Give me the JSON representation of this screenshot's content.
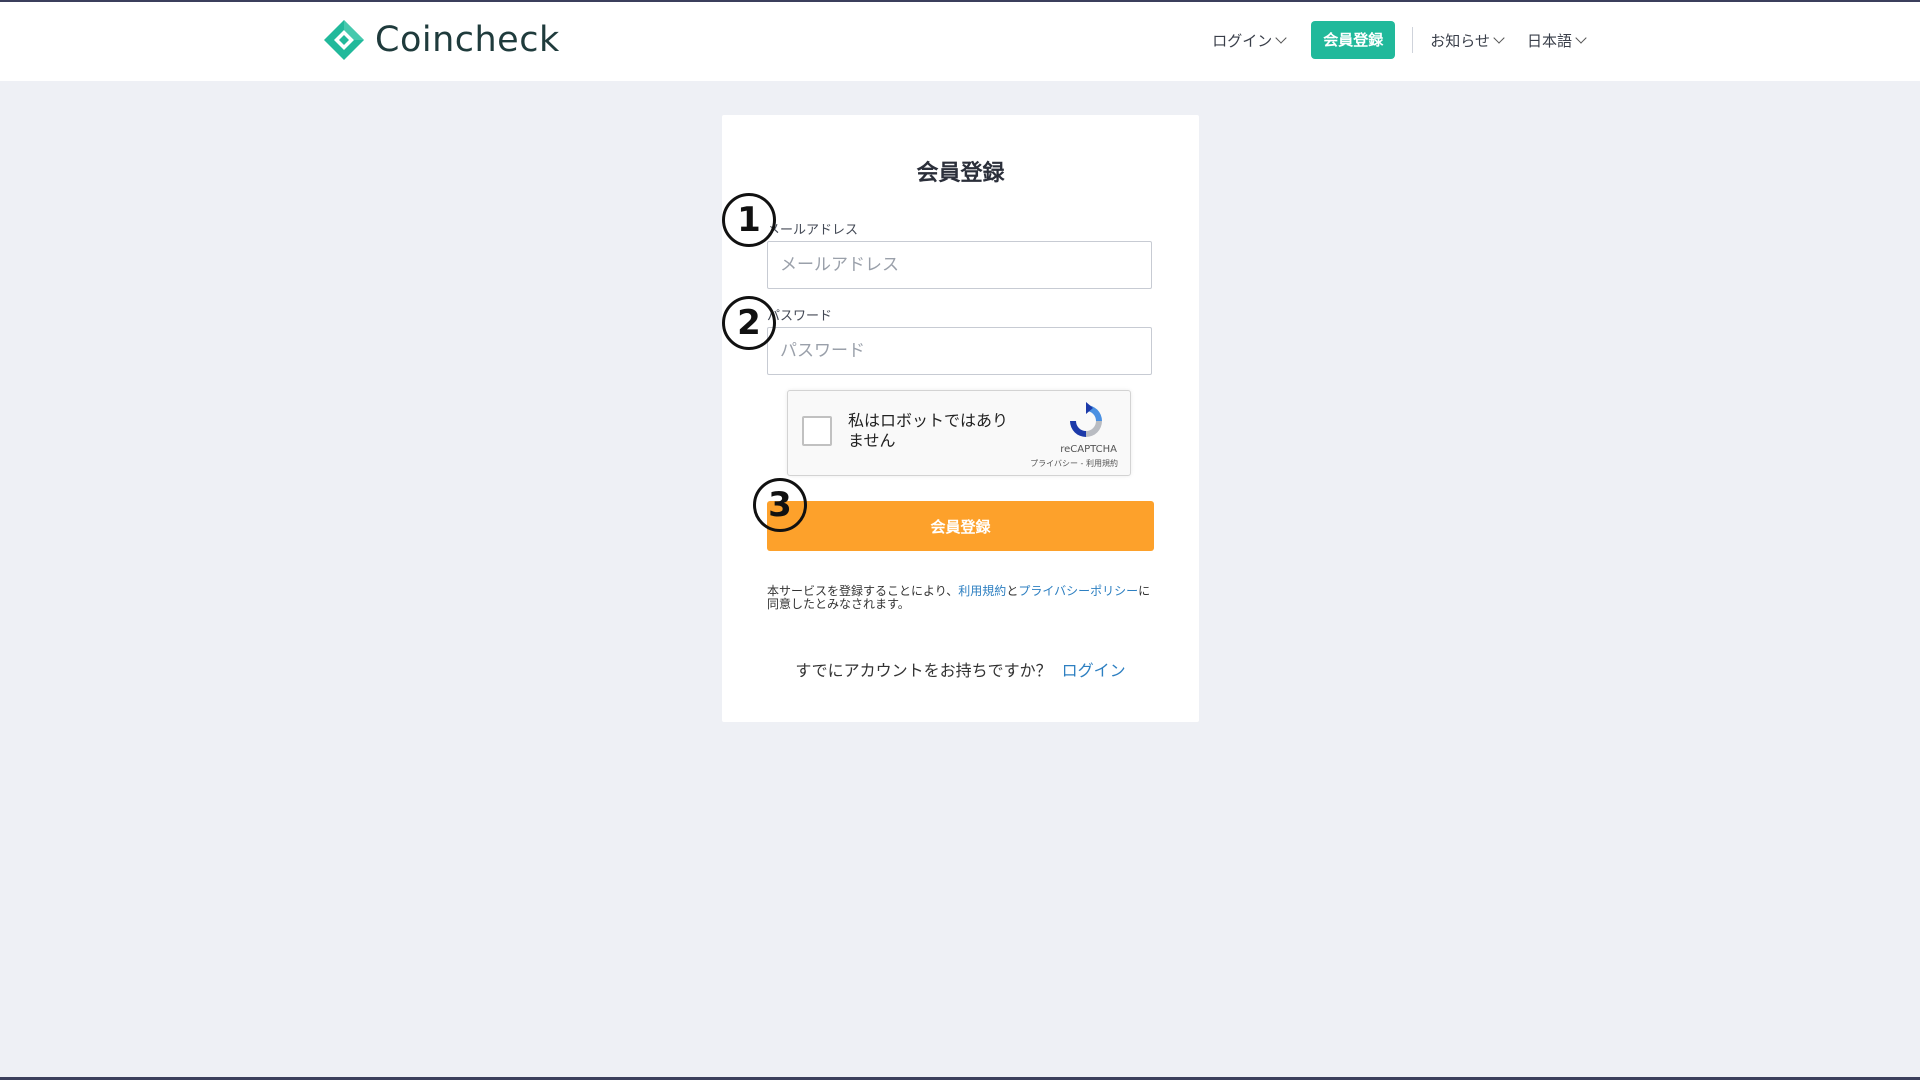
{
  "header": {
    "brand_name": "Coincheck",
    "nav": {
      "login_label": "ログイン",
      "signup_label": "会員登録",
      "news_label": "お知らせ",
      "language_label": "日本語"
    }
  },
  "form": {
    "title": "会員登録",
    "email": {
      "label": "メールアドレス",
      "placeholder": "メールアドレス",
      "value": ""
    },
    "password": {
      "label": "パスワード",
      "placeholder": "パスワード",
      "value": ""
    },
    "recaptcha": {
      "checkbox_text": "私はロボットではありません",
      "brand": "reCAPTCHA",
      "privacy_link": "プライバシー",
      "separator": " - ",
      "terms_link": "利用規約"
    },
    "submit_label": "会員登録",
    "terms_notice": {
      "prefix": "本サービスを登録することにより、",
      "terms_link": "利用規約",
      "connector": "と",
      "privacy_link": "プライバシーポリシー",
      "suffix": "に同意したとみなされます。"
    },
    "login_prompt": {
      "question": "すでにアカウントをお持ちですか？",
      "link": "ログイン"
    }
  },
  "annotations": {
    "marker_1": "1",
    "marker_2": "2",
    "marker_3": "3"
  },
  "colors": {
    "brand_green": "#21b99b",
    "submit_orange": "#fda12b",
    "link_blue": "#2d7fc1",
    "page_bg": "#eef0f5"
  }
}
